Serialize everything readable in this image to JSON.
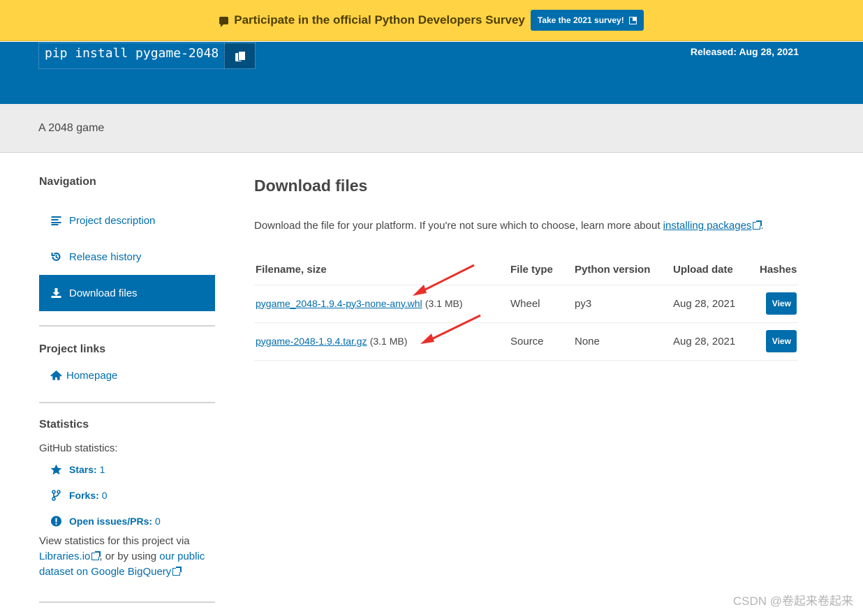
{
  "banner": {
    "message": "Participate in the official Python Developers Survey",
    "button": "Take the 2021 survey!"
  },
  "header": {
    "pip_command": "pip install pygame-2048",
    "released": "Released: Aug 28, 2021"
  },
  "summary": "A 2048 game",
  "sidebar": {
    "navigation_heading": "Navigation",
    "nav_items": [
      {
        "label": "Project description",
        "icon": "list-icon"
      },
      {
        "label": "Release history",
        "icon": "history-icon"
      },
      {
        "label": "Download files",
        "icon": "download-icon",
        "active": true
      }
    ],
    "links_heading": "Project links",
    "links": [
      {
        "label": "Homepage",
        "icon": "home-icon"
      }
    ],
    "statistics_heading": "Statistics",
    "github_label": "GitHub statistics:",
    "stats": [
      {
        "label": "Stars:",
        "value": "1",
        "icon": "star-icon"
      },
      {
        "label": "Forks:",
        "value": "0",
        "icon": "fork-icon"
      },
      {
        "label": "Open issues/PRs:",
        "value": "0",
        "icon": "alert-icon"
      }
    ],
    "stats_text_1": "View statistics for this project via",
    "libraries_link": "Libraries.io",
    "stats_text_2": ", or by using",
    "bigquery_link": "our public dataset on Google BigQuery"
  },
  "main": {
    "heading": "Download files",
    "intro": "Download the file for your platform. If you're not sure which to choose, learn more about",
    "intro_link": "installing packages",
    "intro_end": ".",
    "columns": [
      "Filename, size",
      "File type",
      "Python version",
      "Upload date",
      "Hashes"
    ],
    "rows": [
      {
        "filename": "pygame_2048-1.9.4-py3-none-any.whl",
        "size": "(3.1 MB)",
        "type": "Wheel",
        "python": "py3",
        "date": "Aug 28, 2021",
        "hash_button": "View"
      },
      {
        "filename": "pygame-2048-1.9.4.tar.gz",
        "size": "(3.1 MB)",
        "type": "Source",
        "python": "None",
        "date": "Aug 28, 2021",
        "hash_button": "View"
      }
    ]
  },
  "watermark": "CSDN @卷起来卷起来",
  "colors": {
    "banner": "#ffd343",
    "primary": "#006dad",
    "annotation_arrow": "#e8302a"
  }
}
